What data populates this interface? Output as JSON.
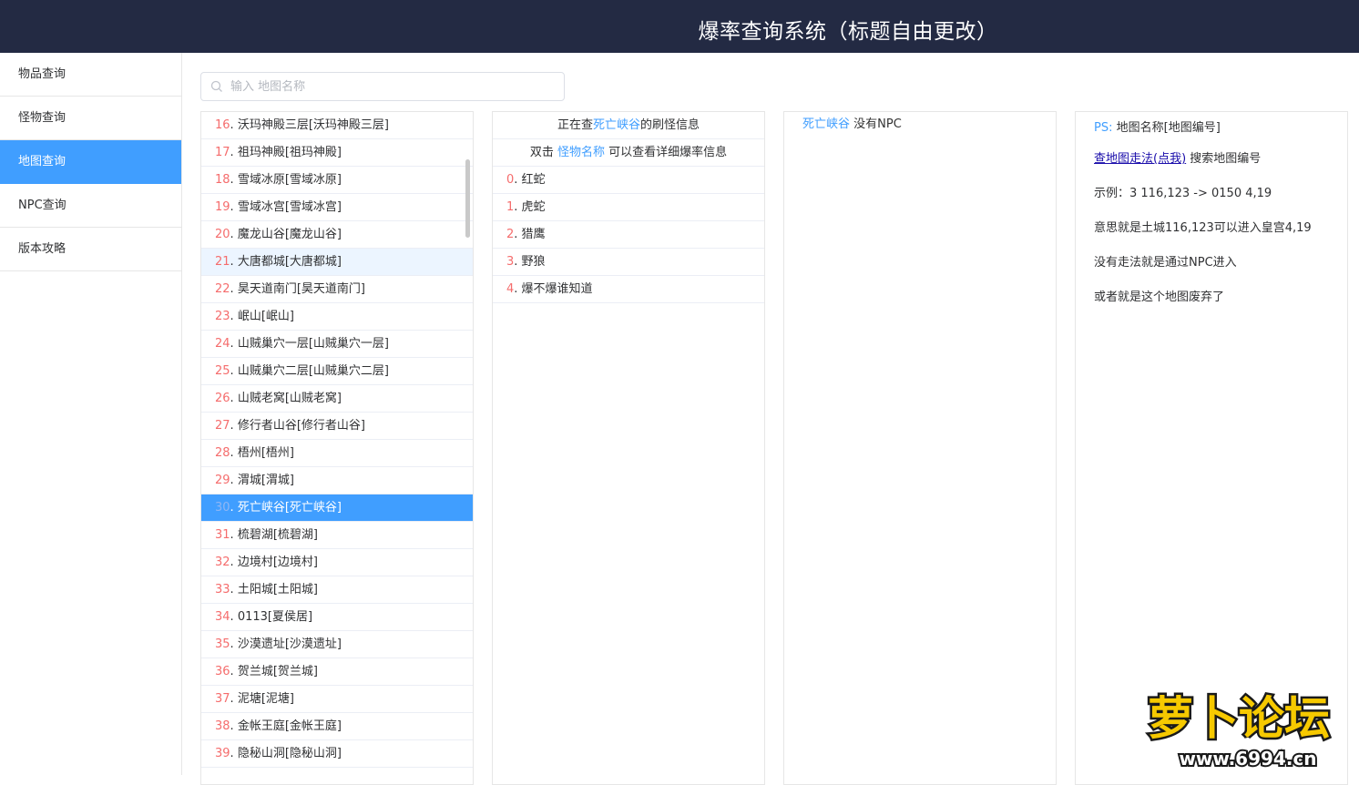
{
  "header": {
    "title": "爆率查询系统（标题自由更改）"
  },
  "sidebar": {
    "items": [
      {
        "label": "物品查询"
      },
      {
        "label": "怪物查询"
      },
      {
        "label": "地图查询"
      },
      {
        "label": "NPC查询"
      },
      {
        "label": "版本攻略"
      }
    ],
    "active_index": 2
  },
  "search": {
    "placeholder": "输入 地图名称",
    "value": ""
  },
  "map_list": {
    "items": [
      {
        "idx": "16",
        "name": "沃玛神殿三层[沃玛神殿三层]"
      },
      {
        "idx": "17",
        "name": "祖玛神殿[祖玛神殿]"
      },
      {
        "idx": "18",
        "name": "雪域冰原[雪域冰原]"
      },
      {
        "idx": "19",
        "name": "雪域冰宫[雪域冰宫]"
      },
      {
        "idx": "20",
        "name": "魔龙山谷[魔龙山谷]"
      },
      {
        "idx": "21",
        "name": "大唐都城[大唐都城]"
      },
      {
        "idx": "22",
        "name": "昊天道南门[昊天道南门]"
      },
      {
        "idx": "23",
        "name": "岷山[岷山]"
      },
      {
        "idx": "24",
        "name": "山贼巢穴一层[山贼巢穴一层]"
      },
      {
        "idx": "25",
        "name": "山贼巢穴二层[山贼巢穴二层]"
      },
      {
        "idx": "26",
        "name": "山贼老窝[山贼老窝]"
      },
      {
        "idx": "27",
        "name": "修行者山谷[修行者山谷]"
      },
      {
        "idx": "28",
        "name": "梧州[梧州]"
      },
      {
        "idx": "29",
        "name": "渭城[渭城]"
      },
      {
        "idx": "30",
        "name": "死亡峡谷[死亡峡谷]"
      },
      {
        "idx": "31",
        "name": "梳碧湖[梳碧湖]"
      },
      {
        "idx": "32",
        "name": "边境村[边境村]"
      },
      {
        "idx": "33",
        "name": "土阳城[土阳城]"
      },
      {
        "idx": "34",
        "name": "0113[夏侯居]"
      },
      {
        "idx": "35",
        "name": "沙漠遗址[沙漠遗址]"
      },
      {
        "idx": "36",
        "name": "贺兰城[贺兰城]"
      },
      {
        "idx": "37",
        "name": "泥塘[泥塘]"
      },
      {
        "idx": "38",
        "name": "金帐王庭[金帐王庭]"
      },
      {
        "idx": "39",
        "name": "隐秘山洞[隐秘山洞]"
      }
    ],
    "hover_index": 5,
    "selected_index": 14
  },
  "monster_panel": {
    "header_prefix": "正在查",
    "header_map": "死亡峡谷",
    "header_suffix": "的刷怪信息",
    "hint_prefix": "双击",
    "hint_link": "怪物名称",
    "hint_suffix": "可以查看详细爆率信息",
    "items": [
      {
        "idx": "0",
        "name": "红蛇"
      },
      {
        "idx": "1",
        "name": "虎蛇"
      },
      {
        "idx": "2",
        "name": "猎鹰"
      },
      {
        "idx": "3",
        "name": "野狼"
      },
      {
        "idx": "4",
        "name": "爆不爆谁知道"
      }
    ]
  },
  "npc_panel": {
    "map": "死亡峡谷",
    "text": "没有NPC"
  },
  "help_panel": {
    "ps_label": "PS:",
    "ps_text": "地图名称[地图编号]",
    "link_text": "查地图走法(点我)",
    "link_suffix": "搜索地图编号",
    "example": "示例：3 116,123 -> 0150 4,19",
    "meaning": "意思就是土城116,123可以进入皇宫4,19",
    "no_path": "没有走法就是通过NPC进入",
    "abandoned": "或者就是这个地图废弃了"
  },
  "watermark": {
    "brand": "萝卜论坛",
    "url": "www.6994.cn"
  },
  "colors": {
    "header_bg": "#232a43",
    "accent": "#409eff",
    "index_red": "#f56c6c"
  }
}
